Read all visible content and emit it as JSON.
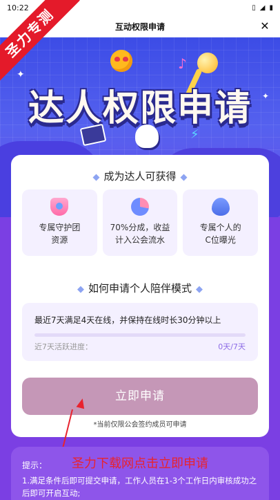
{
  "statusbar": {
    "time": "10:22"
  },
  "header": {
    "title": "互动权限申请",
    "close_icon": "close-icon"
  },
  "badge": {
    "text": "圣力专测"
  },
  "hero": {
    "title": "达人权限申请"
  },
  "benefits_section": {
    "title": "成为达人可获得",
    "items": [
      {
        "icon": "shield-icon",
        "line1": "专属守护团",
        "line2": "资源"
      },
      {
        "icon": "pie-chart-icon",
        "line1": "70%分成，收益",
        "line2": "计入公会流水"
      },
      {
        "icon": "flame-icon",
        "line1": "专属个人的",
        "line2": "C位曝光"
      }
    ]
  },
  "mode_section": {
    "title": "如何申请个人陪伴模式",
    "requirement": "最近7天满足4天在线，并保持在线时长30分钟以上",
    "progress_label": "近7天活跃进度：",
    "progress_value": "0天/7天",
    "progress_fraction": 0
  },
  "apply": {
    "button_label": "立即申请",
    "note": "*当前仅限公会签约成员可申请"
  },
  "tips": {
    "label": "提示：",
    "text": "1.满足条件后即可提交申请，工作人员在1-3个工作日内审核成功之后即可开启互动;"
  },
  "annotation": {
    "text": "圣力下载网点击立即申请"
  },
  "colors": {
    "accent": "#9b6ff0",
    "button": "#c597b7",
    "badge": "#e41a2a",
    "annotation": "#e8232e"
  }
}
